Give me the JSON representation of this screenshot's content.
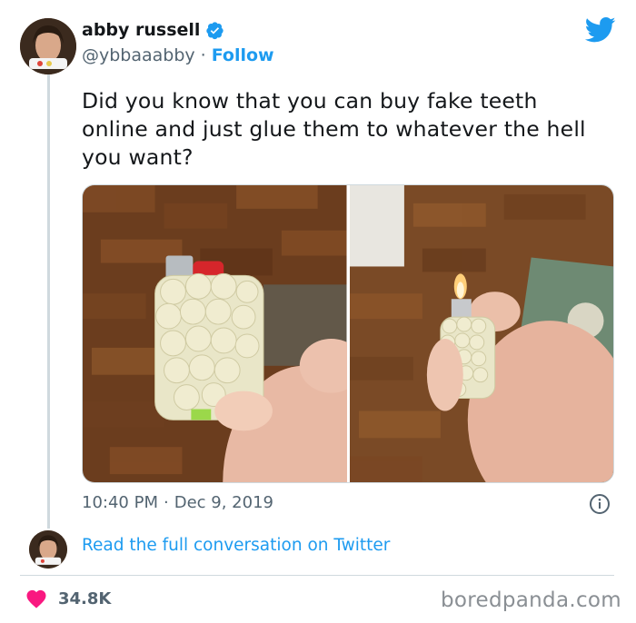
{
  "author": {
    "name": "abby russell",
    "handle": "@ybbaaabby",
    "separator": "·",
    "follow_label": "Follow",
    "verified": true
  },
  "tweet": {
    "text": "Did you know that you can buy fake teeth online and just glue them to whatever the hell you want?",
    "time": "10:40 PM",
    "separator": "·",
    "date": "Dec 9, 2019"
  },
  "conversation_link": "Read the full conversation on Twitter",
  "likes": "34.8K",
  "watermark": "boredpanda.com",
  "icons": [
    "verified-badge-icon",
    "twitter-bird-icon",
    "info-icon",
    "heart-icon"
  ],
  "colors": {
    "accent": "#1d9bf0",
    "heart": "#f91880",
    "secondary_text": "#536471"
  }
}
